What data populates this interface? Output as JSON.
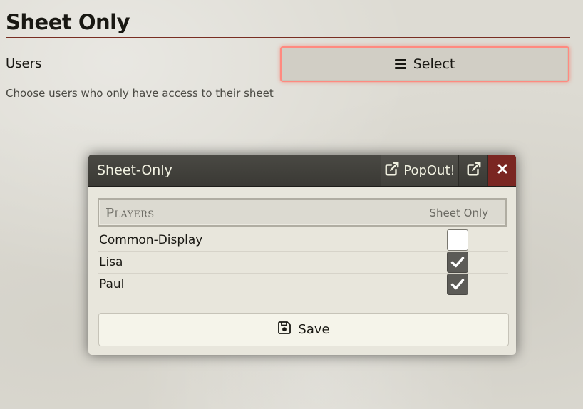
{
  "page": {
    "title": "Sheet Only",
    "users_label": "Users",
    "select_label": "Select",
    "hint": "Choose users who only have access to their sheet"
  },
  "dialog": {
    "title": "Sheet-Only",
    "popout_label": "PopOut!",
    "columns": {
      "players": "Players",
      "sheet_only": "Sheet Only"
    },
    "rows": [
      {
        "name": "Common-Display",
        "sheet_only": false
      },
      {
        "name": "Lisa",
        "sheet_only": true
      },
      {
        "name": "Paul",
        "sheet_only": true
      }
    ],
    "save_label": "Save"
  },
  "icons": {
    "select": "bars-icon",
    "popout": "external-link-icon",
    "external": "external-link-icon",
    "close": "close-icon",
    "save": "floppy-disk-icon",
    "checked": "checkmark-icon"
  },
  "colors": {
    "header_bg": "#3f3e39",
    "close_bg": "#7a2622",
    "title_rule": "#782e22",
    "select_glow": "#ff8a80",
    "checkbox_on": "#5c5b57"
  }
}
